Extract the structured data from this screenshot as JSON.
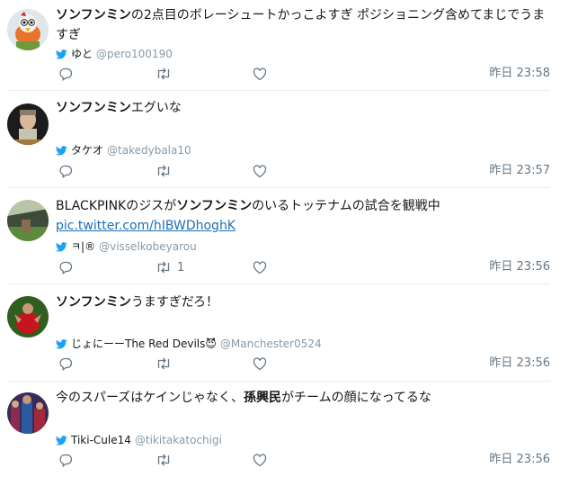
{
  "tweets": [
    {
      "text_parts": [
        {
          "t": "ソンフンミン",
          "bold": true
        },
        {
          "t": "の2点目のボレーシュートかっこよすぎ ポジショニング含めてまじでうますぎ",
          "bold": false
        }
      ],
      "name": "ゆと",
      "handle": "@pero100190",
      "time": "昨日 23:58",
      "retweets": "",
      "avatar_icon": "bird-avatar-icon"
    },
    {
      "text_parts": [
        {
          "t": "ソンフンミン",
          "bold": true
        },
        {
          "t": "エグいな",
          "bold": false
        }
      ],
      "name": "タケオ",
      "handle": "@takedybala10",
      "time": "昨日 23:57",
      "retweets": "",
      "avatar_icon": "figure-avatar-icon"
    },
    {
      "text_parts": [
        {
          "t": "BLACKPINKのジスが",
          "bold": false
        },
        {
          "t": "ソンフンミン",
          "bold": true
        },
        {
          "t": "のいるトッテナムの試合を観戦中",
          "bold": false
        }
      ],
      "link": "pic.twitter.com/hIBWDhoghK",
      "name": "ㅋ|®",
      "handle": "@visselkobeyarou",
      "time": "昨日 23:56",
      "retweets": "1",
      "avatar_icon": "stadium-avatar-icon"
    },
    {
      "text_parts": [
        {
          "t": "ソンフンミン",
          "bold": true
        },
        {
          "t": "うますぎだろ！",
          "bold": false
        }
      ],
      "name": "じょにーーThe Red Devils😈",
      "handle": "@Manchester0524",
      "time": "昨日 23:56",
      "retweets": "",
      "avatar_icon": "player-avatar-icon"
    },
    {
      "text_parts": [
        {
          "t": "今のスパーズはケインじゃなく、",
          "bold": false
        },
        {
          "t": "孫興民",
          "bold": true
        },
        {
          "t": "がチームの顔になってるな",
          "bold": false
        }
      ],
      "name": "Tiki-Cule14",
      "handle": "@tikitakatochigi",
      "time": "昨日 23:56",
      "retweets": "",
      "avatar_icon": "team-avatar-icon"
    }
  ],
  "colors": {
    "twitter_blue": "#1da1f2",
    "link": "#1b6fb5",
    "muted": "#657786",
    "separator": "#e6ecf0"
  }
}
